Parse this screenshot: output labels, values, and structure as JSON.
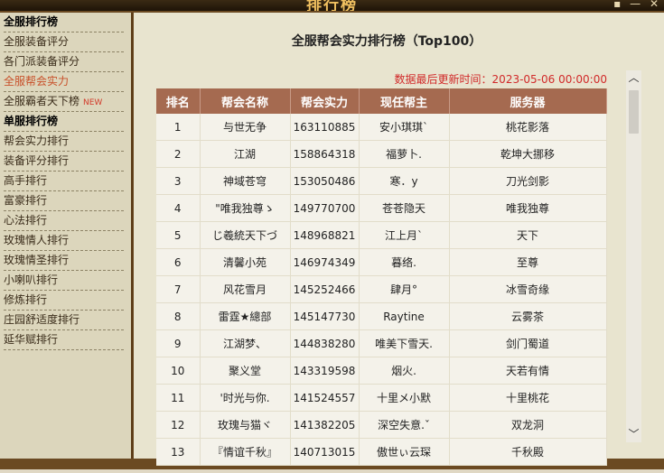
{
  "window": {
    "title": "排行榜",
    "controls": [
      "▪",
      "—",
      "✕"
    ]
  },
  "sidebar": {
    "items": [
      {
        "label": "全服排行榜",
        "kind": "head"
      },
      {
        "label": "全服装备评分",
        "kind": "item"
      },
      {
        "label": "各门派装备评分",
        "kind": "item"
      },
      {
        "label": "全服帮会实力",
        "kind": "active"
      },
      {
        "label": "全服霸者天下榜",
        "kind": "item",
        "badge": "NEW"
      },
      {
        "label": "单服排行榜",
        "kind": "head"
      },
      {
        "label": "帮会实力排行",
        "kind": "item"
      },
      {
        "label": "装备评分排行",
        "kind": "item"
      },
      {
        "label": "高手排行",
        "kind": "item"
      },
      {
        "label": "富豪排行",
        "kind": "item"
      },
      {
        "label": "心法排行",
        "kind": "item"
      },
      {
        "label": "玫瑰情人排行",
        "kind": "item"
      },
      {
        "label": "玫瑰情圣排行",
        "kind": "item"
      },
      {
        "label": "小喇叭排行",
        "kind": "item"
      },
      {
        "label": "修炼排行",
        "kind": "item"
      },
      {
        "label": "庄园舒适度排行",
        "kind": "item"
      },
      {
        "label": "延华赋排行",
        "kind": "item"
      }
    ]
  },
  "main": {
    "title": "全服帮会实力排行榜（Top100）",
    "updated": "数据最后更新时间：2023-05-06 00:00:00",
    "columns": [
      "排名",
      "帮会名称",
      "帮会实力",
      "现任帮主",
      "服务器"
    ],
    "rows": [
      [
        "1",
        "与世无争",
        "163110885",
        "安小琪琪`",
        "桃花影落"
      ],
      [
        "2",
        "江湖",
        "158864318",
        "福萝卜.",
        "乾坤大挪移"
      ],
      [
        "3",
        "神域苍穹",
        "153050486",
        "寒．y",
        "刀光剑影"
      ],
      [
        "4",
        "\"唯我独尊ゝ",
        "149770700",
        "苍苍隐天",
        "唯我独尊"
      ],
      [
        "5",
        "じ羲統天下づ",
        "148968821",
        "江上月`",
        "天下"
      ],
      [
        "6",
        "清馨小苑",
        "146974349",
        "暮络.",
        "至尊"
      ],
      [
        "7",
        "风花雪月",
        "145252466",
        "肆月°",
        "冰雪奇缘"
      ],
      [
        "8",
        "雷霆★總部",
        "145147730",
        "Raytine",
        "云雾茶"
      ],
      [
        "9",
        "江湖梦、",
        "144838280",
        "唯美下雪天.",
        "剑门蜀道"
      ],
      [
        "10",
        "聚义堂",
        "143319598",
        "烟火.",
        "天若有情"
      ],
      [
        "11",
        "'时光与你.",
        "141524557",
        "十里メ小默",
        "十里桃花"
      ],
      [
        "12",
        "玫瑰与猫ヾ",
        "141382205",
        "深空失意.ˇ",
        "双龙洞"
      ],
      [
        "13",
        "『情谊千秋』",
        "140713015",
        "傲世ぃ云琛",
        "千秋殿"
      ]
    ]
  },
  "colors": {
    "header_bg": "#a56a50",
    "accent_red": "#d12a2a",
    "active_link": "#c8502a"
  }
}
